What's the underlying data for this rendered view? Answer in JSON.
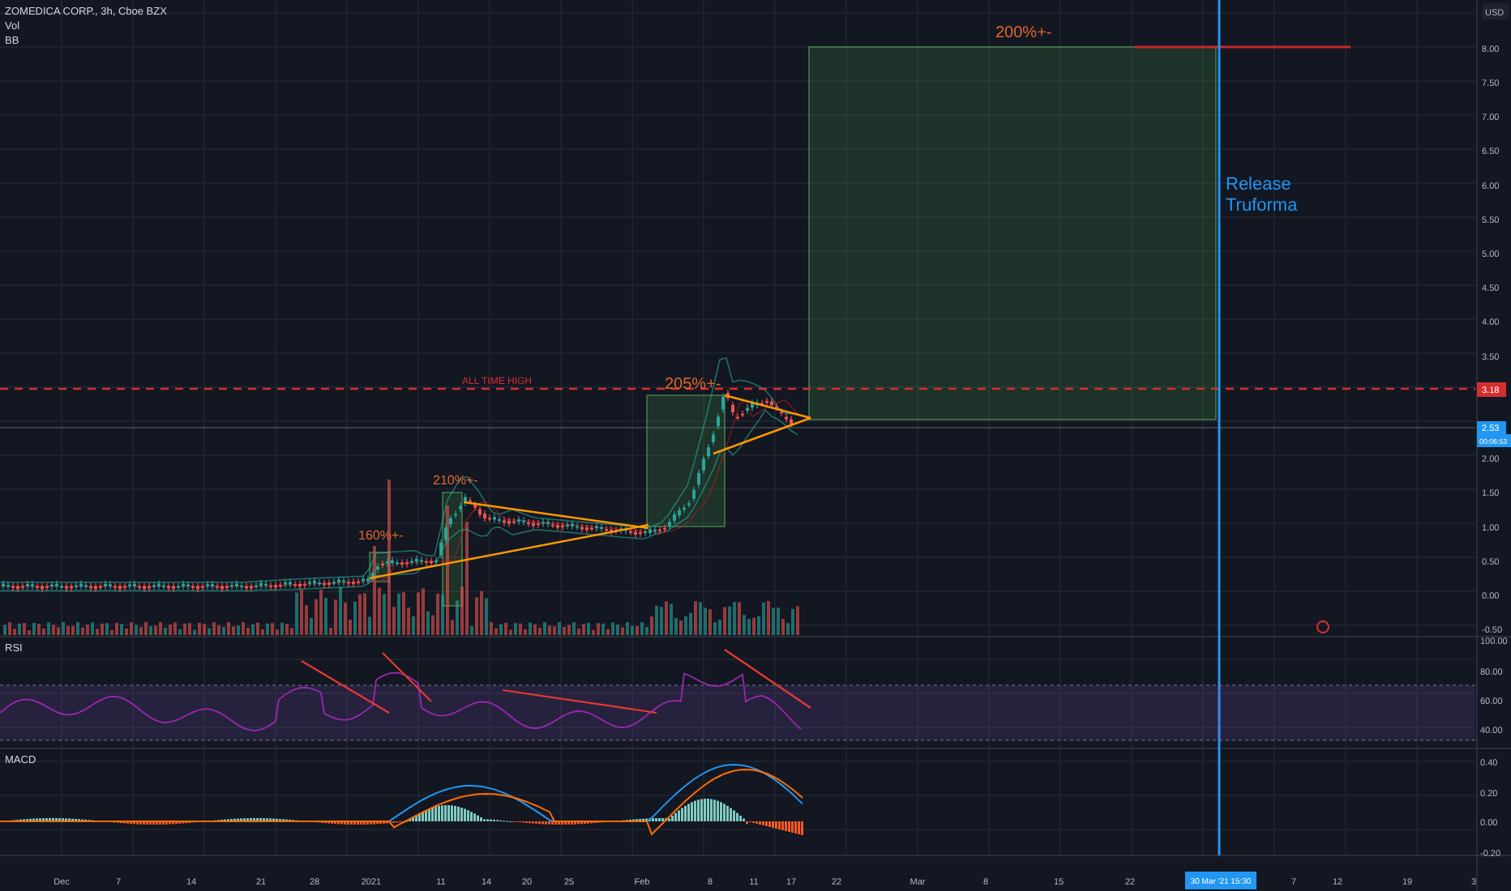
{
  "legend": [
    "ZOMEDICA CORP., 3h, Cboe BZX",
    "Vol",
    "BB"
  ],
  "price_axis": {
    "currency": "USD",
    "ticks": [
      "8.00",
      "7.50",
      "7.00",
      "6.50",
      "6.00",
      "5.50",
      "5.00",
      "4.50",
      "4.00",
      "3.50",
      "2.00",
      "1.50",
      "1.00",
      "0.50",
      "0.00",
      "-0.50"
    ],
    "alert_level": "3.18",
    "last_price": "2.53",
    "countdown": "00:06:53"
  },
  "annotations": [
    {
      "text": "200%+-",
      "color": "#e0662c"
    },
    {
      "text": "Release\nTruforma",
      "color": "#2196f3"
    },
    {
      "text": "ALL TIME HIGH",
      "color": "#d32f2f"
    },
    {
      "text": "205%+-",
      "color": "#e0662c"
    },
    {
      "text": "210%+-",
      "color": "#e0662c"
    },
    {
      "text": "160%+-",
      "color": "#e0662c"
    }
  ],
  "rsi": {
    "title": "RSI",
    "ticks": [
      "100.00",
      "80.00",
      "60.00",
      "40.00"
    ]
  },
  "macd": {
    "title": "MACD",
    "ticks": [
      "0.40",
      "0.20",
      "0.00",
      "-0.20"
    ]
  },
  "time_axis": {
    "ticks": [
      "Dec",
      "7",
      "14",
      "21",
      "28",
      "2021",
      "11",
      "14",
      "20",
      "25",
      "Feb",
      "8",
      "11",
      "17",
      "22",
      "Mar",
      "8",
      "15",
      "22",
      "7",
      "12",
      "19",
      "3"
    ],
    "cursor_date": "30 Mar '21  15:30"
  }
}
